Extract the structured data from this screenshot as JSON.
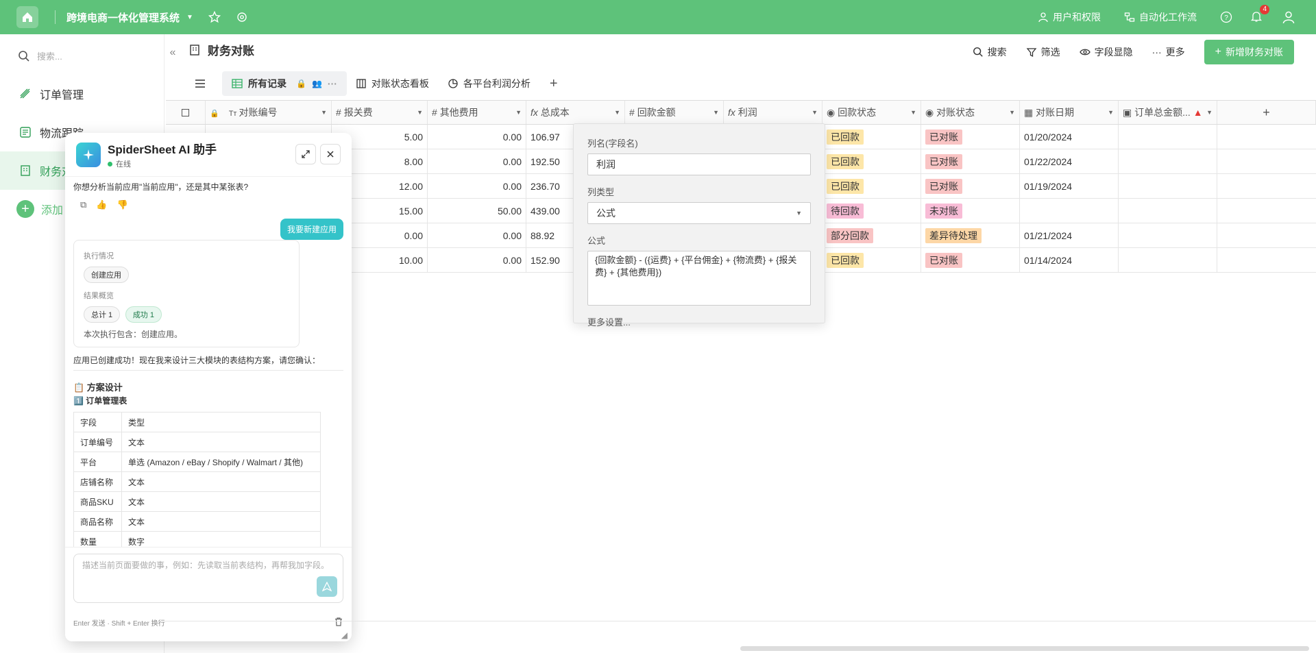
{
  "topbar": {
    "app_title": "跨境电商一体化管理系统",
    "users_permissions": "用户和权限",
    "automation": "自动化工作流",
    "notification_count": "4"
  },
  "sidebar": {
    "search_placeholder": "搜索...",
    "items": [
      {
        "label": "订单管理"
      },
      {
        "label": "物流跟踪"
      },
      {
        "label": "财务对"
      }
    ],
    "add_label": "添加"
  },
  "main": {
    "title": "财务对账",
    "actions": {
      "search": "搜索",
      "filter": "筛选",
      "field_display": "字段显隐",
      "more": "更多",
      "new": "新增财务对账"
    },
    "tabs": [
      {
        "label": "所有记录"
      },
      {
        "label": "对账状态看板"
      },
      {
        "label": "各平台利润分析"
      }
    ]
  },
  "table": {
    "columns": [
      "对账编号",
      "报关费",
      "其他费用",
      "总成本",
      "回款金额",
      "利润",
      "回款状态",
      "对账状态",
      "对账日期",
      "订单总金额..."
    ],
    "rows": [
      {
        "customs": "5.00",
        "other": "0.00",
        "cost": "106.97",
        "payment_status": "已回款",
        "recon_status": "已对账",
        "date": "01/20/2024"
      },
      {
        "customs": "8.00",
        "other": "0.00",
        "cost": "192.50",
        "payment_status": "已回款",
        "recon_status": "已对账",
        "date": "01/22/2024"
      },
      {
        "customs": "12.00",
        "other": "0.00",
        "cost": "236.70",
        "payment_status": "已回款",
        "recon_status": "已对账",
        "date": "01/19/2024"
      },
      {
        "customs": "15.00",
        "other": "50.00",
        "cost": "439.00",
        "payment_status": "待回款",
        "recon_status": "未对账",
        "date": ""
      },
      {
        "customs": "0.00",
        "other": "0.00",
        "cost": "88.92",
        "payment_status": "部分回款",
        "recon_status": "差异待处理",
        "date": "01/21/2024"
      },
      {
        "customs": "10.00",
        "other": "0.00",
        "cost": "152.90",
        "payment_status": "已回款",
        "recon_status": "已对账",
        "date": "01/14/2024"
      }
    ]
  },
  "popover": {
    "name_label": "列名(字段名)",
    "name_value": "利润",
    "type_label": "列类型",
    "type_value": "公式",
    "formula_label": "公式",
    "formula_value": "{回款金额} - ({运费} + {平台佣金} + {物流费} + {报关费} + {其他费用})",
    "more_settings": "更多设置..."
  },
  "assistant": {
    "title": "SpiderSheet AI 助手",
    "status": "在线",
    "msg1": "你想分析当前应用\"当前应用\"，还是其中某张表?",
    "user_msg": "我要新建应用",
    "exec_label": "执行情况",
    "exec_chip": "创建应用",
    "result_label": "结果概览",
    "total_chip": "总计 1",
    "success_chip": "成功 1",
    "exec_summary": "本次执行包含：创建应用。",
    "msg2": "应用已创建成功！现在我来设计三大模块的表结构方案，请您确认：",
    "plan_title": "📋 方案设计",
    "section_title": "1️⃣ 订单管理表",
    "plan_rows": [
      {
        "field": "字段",
        "type": "类型"
      },
      {
        "field": "订单编号",
        "type": "文本"
      },
      {
        "field": "平台",
        "type": "单选 (Amazon / eBay / Shopify / Walmart / 其他)"
      },
      {
        "field": "店铺名称",
        "type": "文本"
      },
      {
        "field": "商品SKU",
        "type": "文本"
      },
      {
        "field": "商品名称",
        "type": "文本"
      },
      {
        "field": "数量",
        "type": "数字"
      }
    ],
    "input_placeholder": "描述当前页面要做的事，例如：先读取当前表结构，再帮我加字段。",
    "footer_hint": "Enter 发送 · Shift + Enter 换行"
  },
  "colors": {
    "brand": "#5ec27a",
    "assistant_accent": "#34c3c9"
  }
}
